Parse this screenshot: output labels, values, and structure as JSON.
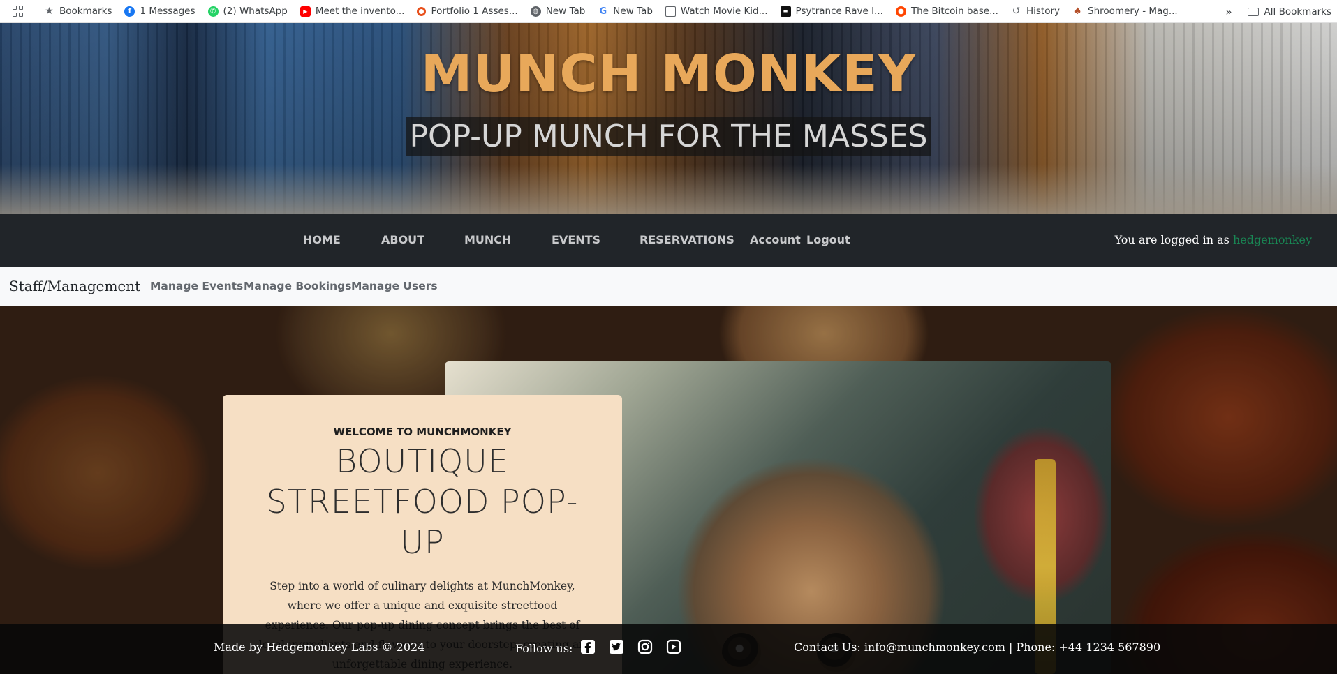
{
  "bookmarks_bar": {
    "items": [
      {
        "label": "Bookmarks",
        "icon": "star-icon"
      },
      {
        "label": "1 Messages",
        "icon": "facebook-icon"
      },
      {
        "label": "(2) WhatsApp",
        "icon": "whatsapp-icon"
      },
      {
        "label": "Meet the invento...",
        "icon": "youtube-icon"
      },
      {
        "label": "Portfolio 1 Asses...",
        "icon": "circle-icon"
      },
      {
        "label": "New Tab",
        "icon": "globe-icon"
      },
      {
        "label": "New Tab",
        "icon": "google-icon"
      },
      {
        "label": "Watch Movie Kid...",
        "icon": "page-icon"
      },
      {
        "label": "Psytrance Rave I...",
        "icon": "site-icon"
      },
      {
        "label": "The Bitcoin base...",
        "icon": "reddit-icon"
      },
      {
        "label": "History",
        "icon": "history-icon"
      },
      {
        "label": "Shroomery - Mag...",
        "icon": "mushroom-icon"
      }
    ],
    "overflow_label": "»",
    "all_bookmarks": "All Bookmarks"
  },
  "hero": {
    "title": "MUNCH MONKEY",
    "subtitle": "POP-UP MUNCH FOR THE MASSES"
  },
  "navbar": {
    "links": [
      "HOME",
      "ABOUT",
      "MUNCH",
      "EVENTS",
      "RESERVATIONS",
      "Account",
      "Logout"
    ],
    "logged_in_prefix": "You are logged in as",
    "username": "hedgemonkey"
  },
  "staff_bar": {
    "brand": "Staff/Management",
    "links": [
      "Manage Events",
      "Manage Bookings",
      "Manage Users"
    ]
  },
  "welcome": {
    "kicker": "WELCOME TO MUNCHMONKEY",
    "title": "BOUTIQUE STREETFOOD POP-UP",
    "body": "Step into a world of culinary delights at MunchMonkey, where we offer a unique and exquisite streetfood experience. Our pop-up dining concept brings the best of local ingredients and flavours to your doorstep, creating an unforgettable dining experience."
  },
  "footer": {
    "made_by": "Made by Hedgemonkey Labs © 2024",
    "follow": "Follow us:",
    "contact_prefix": "Contact Us:",
    "email": "info@munchmonkey.com",
    "phone_prefix": "| Phone:",
    "phone": "+44 1234 567890"
  },
  "colors": {
    "hero_title": "#e8a85a",
    "navbar_bg": "#212529",
    "username": "#198754",
    "card_bg": "#f6dfc4"
  }
}
